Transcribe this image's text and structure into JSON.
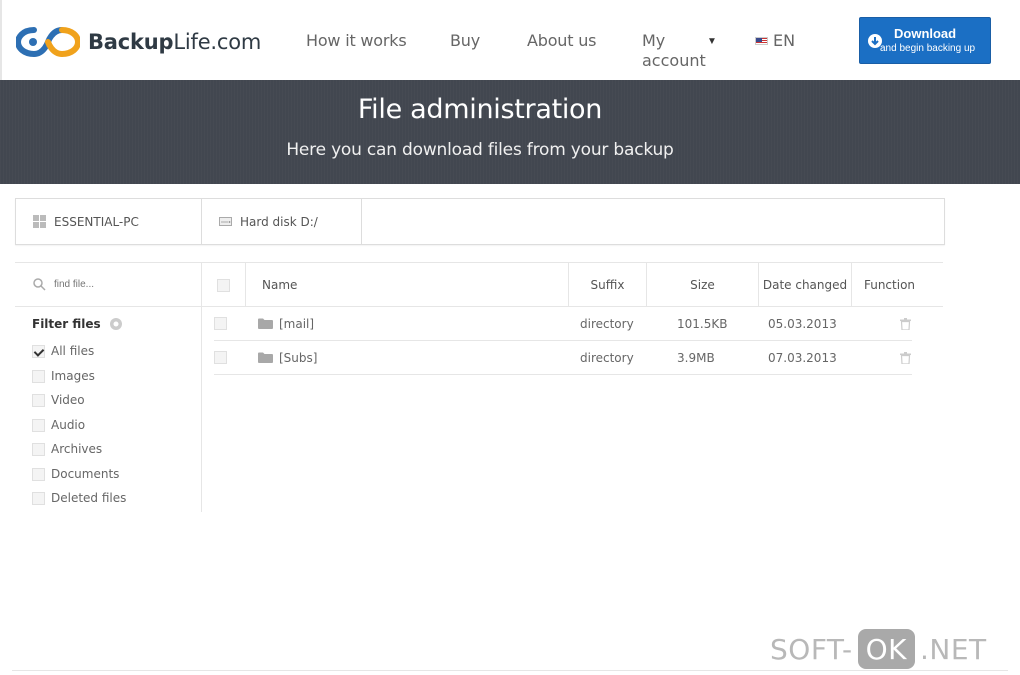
{
  "header": {
    "logo_text_bold": "Backup",
    "logo_text_rest": "Life.com",
    "nav": {
      "how_it_works": "How it works",
      "buy": "Buy",
      "about_us": "About us",
      "my_account": "My account"
    },
    "language": "EN",
    "download_button": {
      "main": "Download",
      "sub": "and begin backing up"
    }
  },
  "banner": {
    "title": "File administration",
    "subtitle": "Here you can download files from your backup"
  },
  "breadcrumb": {
    "computer": "ESSENTIAL-PC",
    "disk": "Hard disk D:/"
  },
  "sidebar": {
    "search_placeholder": "find file...",
    "filter_title": "Filter files",
    "filters": [
      {
        "label": "All files",
        "checked": true
      },
      {
        "label": "Images",
        "checked": false
      },
      {
        "label": "Video",
        "checked": false
      },
      {
        "label": "Audio",
        "checked": false
      },
      {
        "label": "Archives",
        "checked": false
      },
      {
        "label": "Documents",
        "checked": false
      },
      {
        "label": "Deleted files",
        "checked": false
      }
    ]
  },
  "table": {
    "columns": {
      "name": "Name",
      "suffix": "Suffix",
      "size": "Size",
      "date": "Date changed",
      "function": "Function"
    },
    "rows": [
      {
        "name": "[mail]",
        "suffix": "directory",
        "size": "101.5KB",
        "date": "05.03.2013"
      },
      {
        "name": "[Subs]",
        "suffix": "directory",
        "size": "3.9MB",
        "date": "07.03.2013"
      }
    ]
  },
  "watermark": {
    "left": "SOFT-",
    "mid": "OK",
    "right": ".NET"
  },
  "colors": {
    "banner_bg": "#424750",
    "download_blue": "#1b6fc4"
  }
}
